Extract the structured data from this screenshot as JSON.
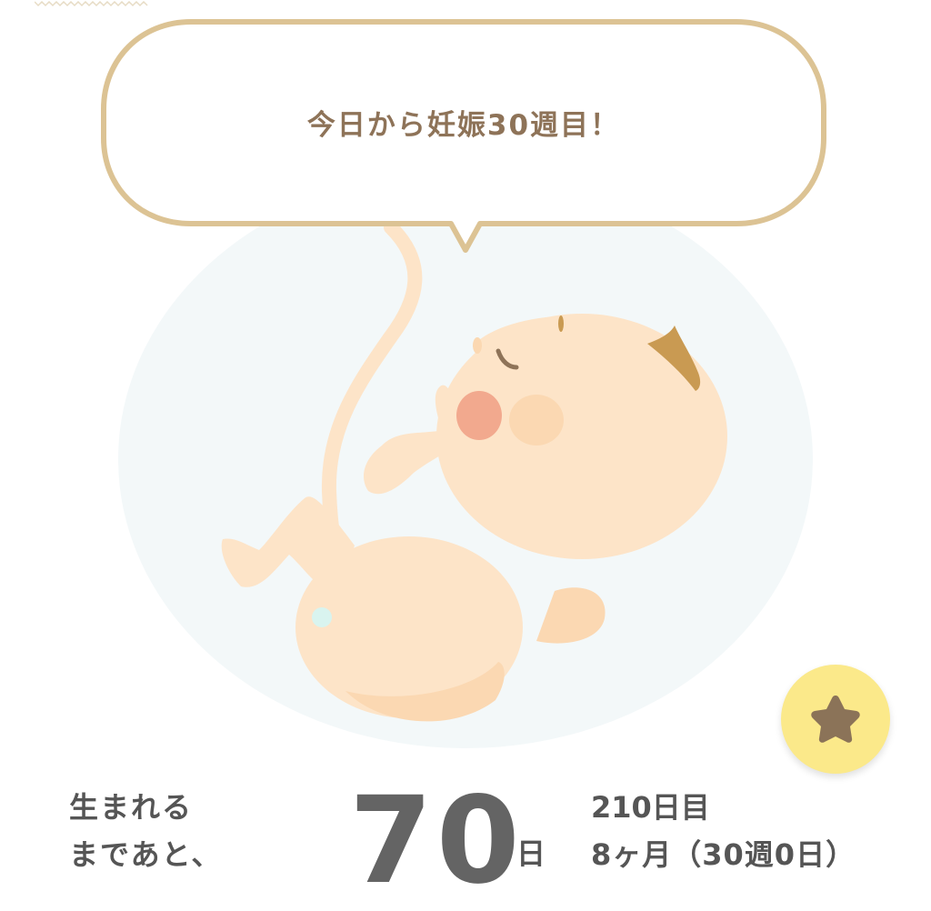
{
  "speech": {
    "message": "今日から妊娠30週目！"
  },
  "illustration": {
    "icon": "fetus-illustration"
  },
  "favorite": {
    "icon": "star-icon"
  },
  "countdown": {
    "label_line1": "生まれる",
    "label_line2": "まであと、",
    "days_remaining": "70",
    "days_unit": "日",
    "day_index": "210日目",
    "month_week": "8ヶ月（30週0日）"
  },
  "colors": {
    "bubble_border": "#dcc394",
    "bubble_text": "#8e7358",
    "womb": "#f3f8f9",
    "skin": "#fde4c8",
    "skin_shadow": "#fbd8b2",
    "cheek": "#f2a98e",
    "hair": "#c99a52",
    "fav_bg": "#fbe98a",
    "star": "#8b7358",
    "text": "#555555"
  }
}
